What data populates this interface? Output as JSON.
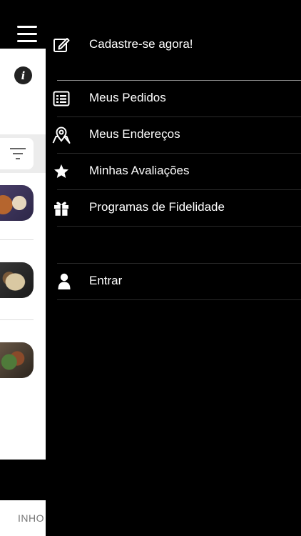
{
  "drawer": {
    "signup_label": "Cadastre-se agora!",
    "items": [
      {
        "label": "Meus Pedidos",
        "icon": "list-alt-icon"
      },
      {
        "label": "Meus Endereços",
        "icon": "map-marker-icon"
      },
      {
        "label": "Minhas Avaliações",
        "icon": "star-icon"
      },
      {
        "label": "Programas de Fidelidade",
        "icon": "gift-icon"
      }
    ],
    "login_label": "Entrar"
  },
  "background_app": {
    "info_symbol": "i",
    "bottom_text": "INHO"
  },
  "colors": {
    "drawer_bg": "#000000",
    "text": "#ffffff",
    "content_bg": "#ffffff",
    "filter_bar_bg": "#ececec"
  }
}
